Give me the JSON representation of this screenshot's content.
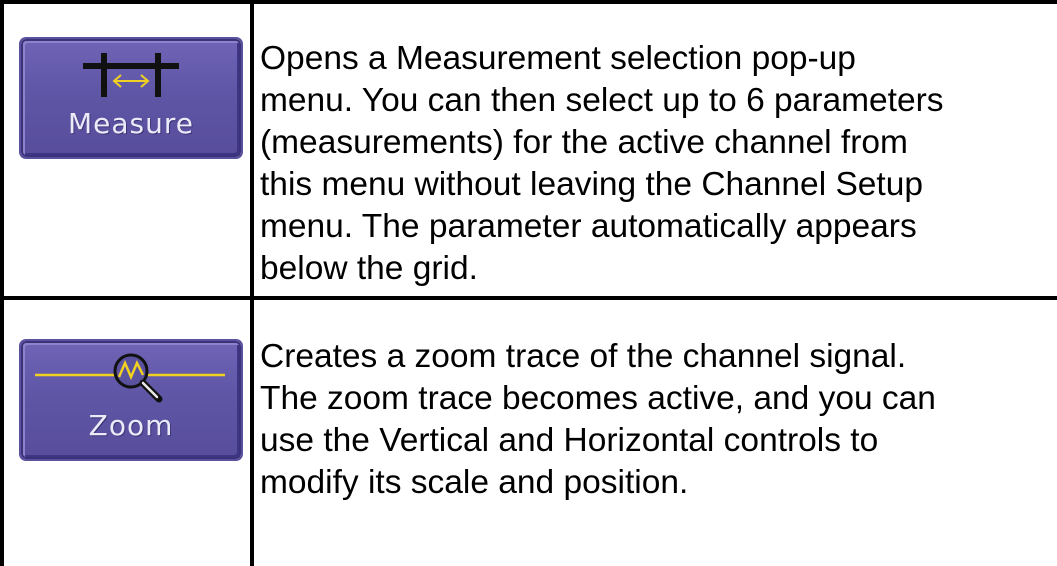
{
  "rows": [
    {
      "button": {
        "label": "Measure",
        "icon": "measure-icon"
      },
      "description": "Opens a Measurement selection pop-up\nmenu.  You can then select up to 6 parameters\n(measurements) for the active channel from\nthis menu without leaving the Channel Setup\nmenu. The parameter automatically appears\nbelow the grid."
    },
    {
      "button": {
        "label": "Zoom",
        "icon": "zoom-icon"
      },
      "description": "Creates a zoom trace of the channel signal.\nThe zoom trace becomes active, and you can\nuse the Vertical and Horizontal controls to\nmodify its scale and position."
    }
  ],
  "colors": {
    "button_face": "#5f56a6",
    "icon_yellow": "#f0d020",
    "text": "#000000"
  }
}
